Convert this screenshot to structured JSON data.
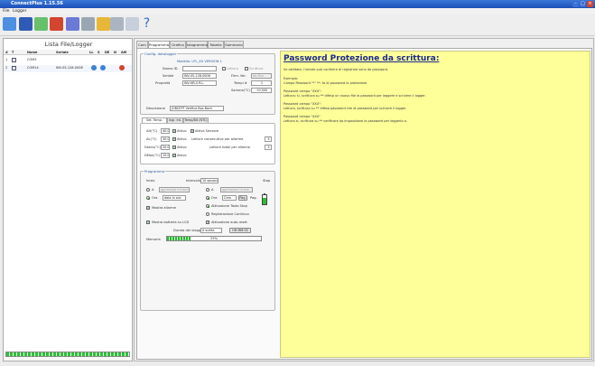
{
  "window": {
    "title": "ConnectPlus 1.15.56"
  },
  "menu": [
    "File",
    "Logger"
  ],
  "left_panel": {
    "title": "Lista File/Logger",
    "columns": [
      "#",
      "T",
      "Nome",
      "Seriale",
      "LL",
      "S",
      "DE",
      "N",
      "AM"
    ],
    "rows": [
      {
        "num": "1",
        "name": "COM3",
        "serial": ""
      },
      {
        "num": "2",
        "name": "COM14",
        "serial": "INV-05-128-0008"
      }
    ]
  },
  "tabs": [
    "Com",
    "Programma",
    "Grafico",
    "Istogramma",
    "Tabella",
    "Sommario"
  ],
  "config": {
    "legend": "Config. datalogger",
    "model": "Modello: LPL_XX VERSION 1",
    "fields": [
      {
        "label": "Nuovo ID",
        "value": ""
      },
      {
        "label": "Seriale",
        "value": "INV-05-128-0008"
      },
      {
        "label": "Proprietà",
        "value": "INV-HR-S.R.L."
      },
      {
        "label": "Descrizione",
        "value": "JOBCEPT Verifica Box Bach"
      }
    ],
    "right_fields": [
      {
        "label": "Firm. Ver.",
        "value": "de-Run"
      },
      {
        "label": "Tempi #",
        "value": "1"
      },
      {
        "label": "Samma(°C)",
        "value": "+0,500"
      }
    ],
    "read_label": "Lettura",
    "write_label": "Scrittura"
  },
  "subtabs": [
    "Set. Temp. (Digital)",
    "Ingr. Int.",
    "Temp/Bit (NTC)"
  ],
  "alarms": [
    {
      "label": "AH(°C)",
      "value": "40.0",
      "check": "Attivo"
    },
    {
      "label": "AL(°C)",
      "value": "30.0",
      "check": "Attivo"
    },
    {
      "label": "Dsens(°C)",
      "value": "20.0",
      "check": "Attivo"
    },
    {
      "label": "DMax(°C)",
      "value": "15.0",
      "check": "Attivo"
    }
  ],
  "alarm_sensor": "Attiva Sensore",
  "alarm_consec": "Letture consecutive per allarme",
  "alarm_total": "Letture totali per allarme",
  "alarm_consec_value": "3",
  "alarm_total_value": "3",
  "program": {
    "legend": "Programma",
    "start_label": "Inizio",
    "interval_label": "Intervallo",
    "interval_value": "10 secondi",
    "stop_label": "Stop",
    "radio_at": "A",
    "radio_now": "Ora",
    "date_placeholder": "gg/mm/aa hh:mm",
    "date_now": "data in ora",
    "date_stop": "Crea",
    "date_pag": "Pag.",
    "chk_alarm_show": "Mostra allarme",
    "chk_lcd": "Mostra batteria su LCD",
    "opt_auto_stop": "Attivazione Tasto Stop",
    "opt_log_cont": "Registrazione Continua",
    "opt_auto": "Attivazione auto-reset",
    "duration_label": "Durata del viaggio:",
    "duration_value": "A scelta",
    "duration_field": "HH:MM:SS",
    "memory_label": "Memoria",
    "memory_pct": "25%",
    "memory_fraction": 0.25,
    "battery_fraction": 0.75
  },
  "help": {
    "title": "Password Protezione da scrittura:",
    "lines": [
      "Se abilitato, l'utente può conferire di registrare sono da password.",
      "",
      "Esempio:",
      "Campo Password \"*\" **: fa di password la protezione",
      "",
      "Password campo \"XXX\":",
      "Lettura: sì, scrittura su ** difesa un nuovo file la password per leggere e scrivere il logger.",
      "",
      "Password campo \"XXX\":",
      "Lettura, scrittura su ** difesa password che di password per scrivere il logger.",
      "",
      "Password campo \"XXX\"",
      "Lettura sì, scrittura su ** verificare da imposizione la password per leggerlo a."
    ]
  },
  "colors": {
    "accent": "#1c4fb8",
    "help_bg": "#ffff99",
    "title_blue": "#1b2a8c",
    "progress_green": "#2fbf3a"
  }
}
